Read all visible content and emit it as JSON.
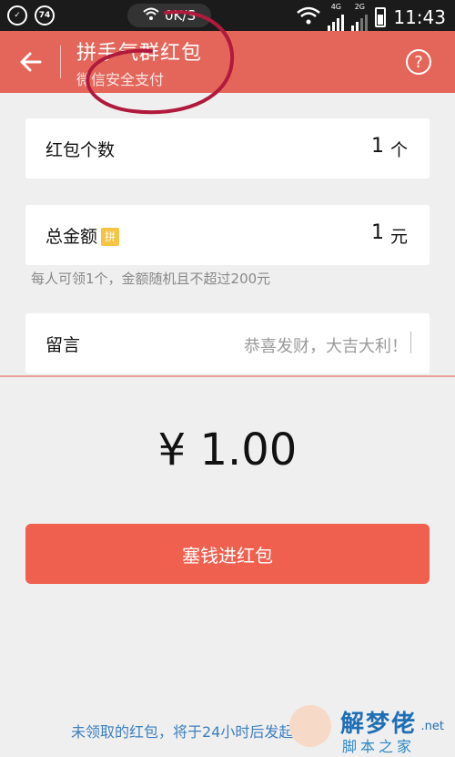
{
  "status_bar": {
    "left_icon_1": "check-shield-icon",
    "left_icon_2_text": "74",
    "speed": "0K/S",
    "net_4g": "4G",
    "net_2g": "2G",
    "time": "11:43"
  },
  "header": {
    "title": "拼手气群红包",
    "subtitle": "微信安全支付",
    "back_icon": "back-arrow-icon",
    "help_label": "?"
  },
  "packet_count": {
    "label": "红包个数",
    "value": "1",
    "unit": "个"
  },
  "total_amount": {
    "label": "总金额",
    "badge": "拼",
    "value": "1",
    "unit": "元"
  },
  "hint": "每人可领1个，金额随机且不超过200元",
  "message": {
    "label": "留言",
    "placeholder": "恭喜发财，大吉大利！"
  },
  "amount_display": "¥ 1.00",
  "submit_label": "塞钱进红包",
  "footer_note": "未领取的红包，将于24小时后发起",
  "watermark": {
    "main": "解梦佬",
    "sub": "脚本之家",
    "net": ".net"
  },
  "colors": {
    "header_bg": "#e4665a",
    "button_bg": "#f0604f",
    "link_blue": "#3d7fbf"
  }
}
